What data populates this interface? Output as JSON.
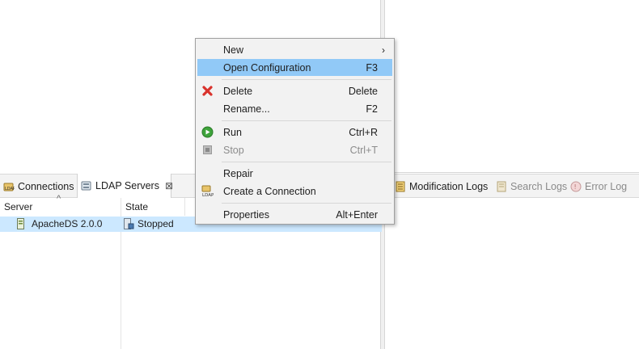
{
  "left_panel": {
    "tabs": [
      {
        "label": "Connections",
        "icon": "connections-icon"
      },
      {
        "label": "LDAP Servers",
        "icon": "ldap-servers-icon",
        "close": "⊠"
      }
    ],
    "columns": [
      "Server",
      "State"
    ],
    "sort_indicator": "^",
    "rows": [
      {
        "server": "ApacheDS 2.0.0",
        "state": "Stopped"
      }
    ]
  },
  "right_panel": {
    "tabs": [
      {
        "label": "Modification Logs",
        "icon": "modification-logs-icon"
      },
      {
        "label": "Search Logs",
        "icon": "search-logs-icon"
      },
      {
        "label": "Error Log",
        "icon": "error-log-icon"
      }
    ]
  },
  "context_menu": {
    "items": [
      {
        "label": "New",
        "shortcut": "",
        "submenu": "›"
      },
      {
        "label": "Open Configuration",
        "shortcut": "F3"
      },
      {
        "label": "Delete",
        "shortcut": "Delete",
        "icon": "delete-icon"
      },
      {
        "label": "Rename...",
        "shortcut": "F2"
      },
      {
        "label": "Run",
        "shortcut": "Ctrl+R",
        "icon": "run-icon"
      },
      {
        "label": "Stop",
        "shortcut": "Ctrl+T",
        "icon": "stop-icon"
      },
      {
        "label": "Repair",
        "shortcut": ""
      },
      {
        "label": "Create a Connection",
        "shortcut": "",
        "icon": "ldap-connection-icon"
      },
      {
        "label": "Properties",
        "shortcut": "Alt+Enter"
      }
    ]
  },
  "colors": {
    "selection": "#cce8ff",
    "menu_highlight": "#91c9f7",
    "menu_bg": "#f2f2f2"
  }
}
